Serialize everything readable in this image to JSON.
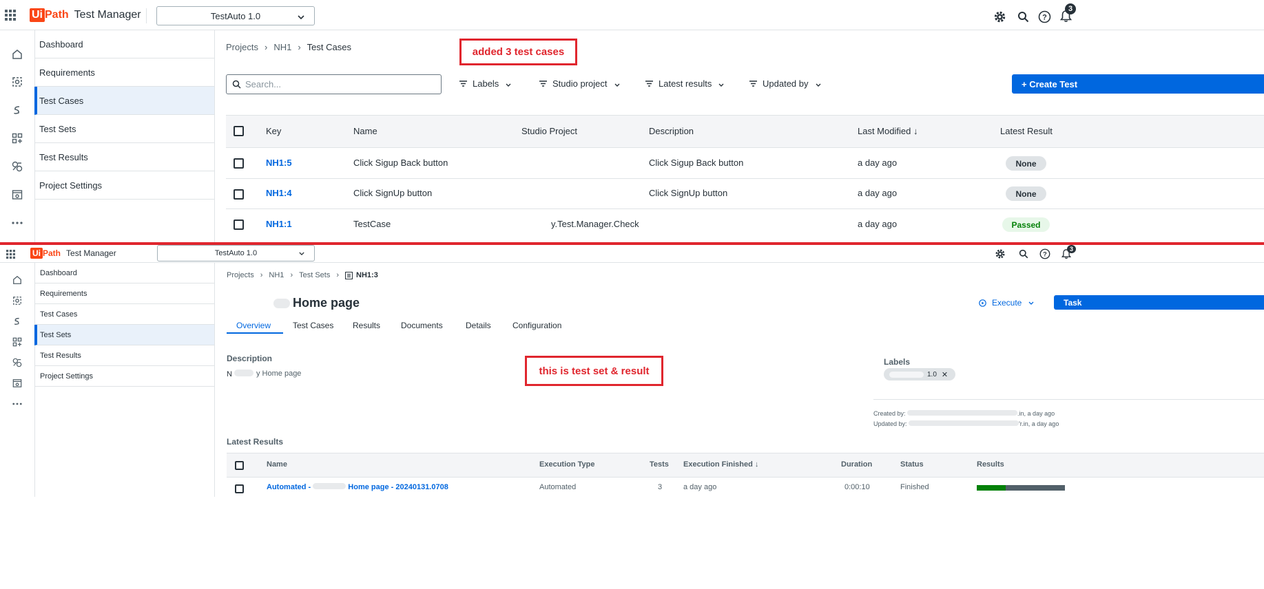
{
  "top": {
    "logo_ui": "Ui",
    "logo_path": "Path",
    "product": "Test Manager",
    "project_selector": "TestAuto 1.0",
    "notification_count": "3",
    "breadcrumb": [
      "Projects",
      "NH1",
      "Test Cases"
    ],
    "callout": "added 3 test cases",
    "nav": [
      "Dashboard",
      "Requirements",
      "Test Cases",
      "Test Sets",
      "Test Results",
      "Project Settings"
    ],
    "active_nav": "Test Cases",
    "search_placeholder": "Search...",
    "filters": [
      "Labels",
      "Studio project",
      "Latest results",
      "Updated by"
    ],
    "create_button": "+ Create Test",
    "columns": [
      "Key",
      "Name",
      "Studio Project",
      "Description",
      "Last Modified",
      "Latest Result"
    ],
    "rows": [
      {
        "key": "NH1:5",
        "name": "Click Sigup Back button",
        "studio": "",
        "description": "Click Sigup Back button",
        "modified": "a day ago",
        "result": "None"
      },
      {
        "key": "NH1:4",
        "name": "Click SignUp button",
        "studio": "",
        "description": "Click SignUp button",
        "modified": "a day ago",
        "result": "None"
      },
      {
        "key": "NH1:1",
        "name": "TestCase",
        "studio": "y.Test.Manager.Check",
        "description": "",
        "modified": "a day ago",
        "result": "Passed"
      }
    ]
  },
  "bottom": {
    "logo_ui": "Ui",
    "logo_path": "Path",
    "product": "Test Manager",
    "project_selector": "TestAuto 1.0",
    "notification_count": "3",
    "breadcrumb": [
      "Projects",
      "NH1",
      "Test Sets",
      "NH1:3"
    ],
    "nav": [
      "Dashboard",
      "Requirements",
      "Test Cases",
      "Test Sets",
      "Test Results",
      "Project Settings"
    ],
    "active_nav": "Test Sets",
    "title": "Home page",
    "execute_button": "Execute",
    "task_button": "Task",
    "tabs": [
      "Overview",
      "Test Cases",
      "Results",
      "Documents",
      "Details",
      "Configuration"
    ],
    "active_tab": "Overview",
    "description_heading": "Description",
    "description_text": "y Home page",
    "callout": "this is test set & result",
    "labels_heading": "Labels",
    "label_chip": "1.0",
    "created_by": "Created by:",
    "created_suffix": ".in, a day ago",
    "updated_by": "Updated by:",
    "updated_suffix": "'r.in, a day ago",
    "latest_results_heading": "Latest Results",
    "columns": [
      "Name",
      "Execution Type",
      "Tests",
      "Execution Finished",
      "Duration",
      "Status",
      "Results"
    ],
    "row": {
      "name_prefix": "Automated -",
      "name_suffix": "Home page - 20240131.0708",
      "execution_type": "Automated",
      "tests": "3",
      "finished": "a day ago",
      "duration": "0:00:10",
      "status": "Finished",
      "passed_fraction": 0.33
    }
  },
  "colors": {
    "accent": "#0067df",
    "callout": "#e0262e",
    "brand": "#fa4616",
    "passed": "#038108",
    "failed_bar": "#526069"
  }
}
